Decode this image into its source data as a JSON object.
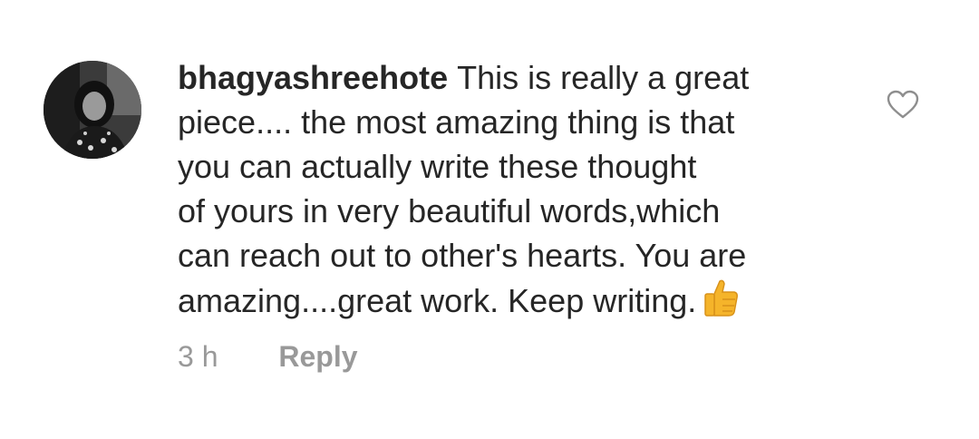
{
  "comment": {
    "username": "bhagyashreehote",
    "text_lines": [
      "This is really a great",
      "piece.... the most amazing thing is that",
      "you can actually write these thought",
      "of yours in very beautiful words,which",
      "can reach out to other's hearts. You are",
      "amazing....great work. Keep writing."
    ],
    "emoji": "thumbs-up-emoji",
    "time": "3 h",
    "reply_label": "Reply",
    "avatar": "profile-avatar-photo",
    "like_icon": "heart-outline-icon"
  },
  "colors": {
    "text": "#262626",
    "muted": "#999999",
    "background": "#ffffff",
    "emoji": "#F5B42A"
  }
}
